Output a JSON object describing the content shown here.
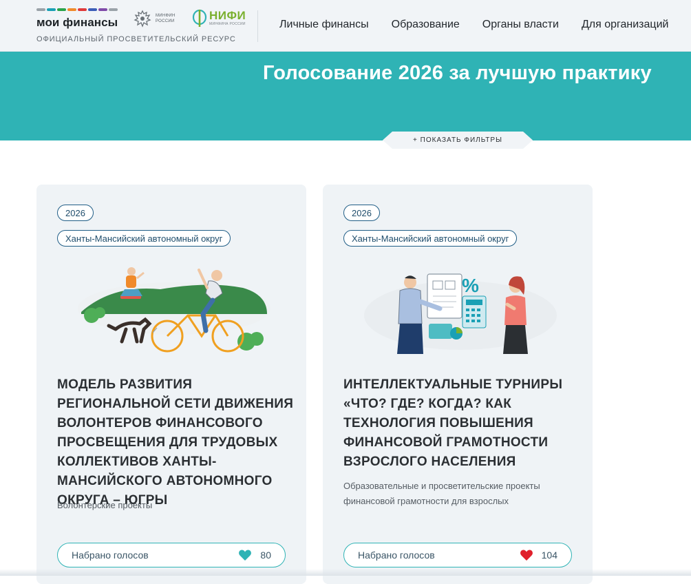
{
  "header": {
    "brand_name": "мои финансы",
    "tagline": "ОФИЦИАЛЬНЫЙ ПРОСВЕТИТЕЛЬСКИЙ РЕСУРС",
    "stripe_colors": [
      "#9aa2a8",
      "#1aa0b5",
      "#2aa34a",
      "#f08a2a",
      "#e03a3a",
      "#3b5db8",
      "#7f4aa8",
      "#9aa2a8"
    ],
    "minfin_label": "МИНФИН РОССИИ",
    "nifi_label": "НИФИ",
    "nifi_sub": "МИНФИНА РОССИИ",
    "nav": [
      "Личные финансы",
      "Образование",
      "Органы власти",
      "Для организаций"
    ]
  },
  "banner": {
    "title": "Голосование 2026 за лучшую практику",
    "filters_label": "+ ПОКАЗАТЬ ФИЛЬТРЫ",
    "color": "#2fb3b5"
  },
  "cards": [
    {
      "year": "2026",
      "region": "Ханты-Мансийский автономный округ",
      "illustration": "volunteer-cyclist-illustration",
      "title": "Модель развития региональной сети движения волонтеров финансового просвещения для трудовых коллективов Ханты-Мансийского автономного округа – Югры",
      "category": "Волонтерские проекты",
      "votes_label": "Набрано голосов",
      "votes_count": "80",
      "heart_icon": "heart-outline-icon",
      "heart_color": "#2fb3b5"
    },
    {
      "year": "2026",
      "region": "Ханты-Мансийский автономный округ",
      "illustration": "finance-quiz-illustration",
      "title": "Интеллектуальные турниры «Что? Где? Когда? как технология повышения финансовой грамотности взрослого населения",
      "category": "Образовательные и просветительские проекты финансовой грамотности для взрослых",
      "votes_label": "Набрано голосов",
      "votes_count": "104",
      "heart_icon": "heart-filled-icon",
      "heart_color": "#e0202b"
    }
  ]
}
